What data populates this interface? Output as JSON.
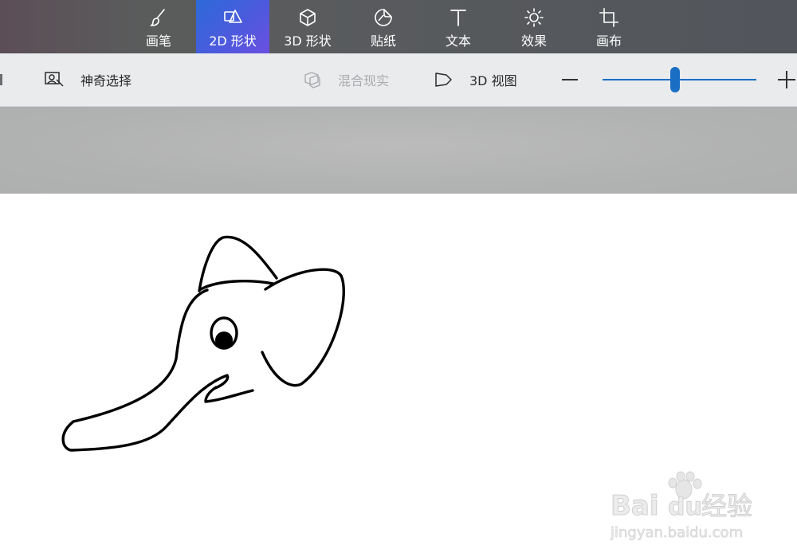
{
  "tabs": [
    {
      "label": "画笔",
      "icon": "brush-icon"
    },
    {
      "label": "2D 形状",
      "icon": "shapes-2d-icon",
      "active": true
    },
    {
      "label": "3D 形状",
      "icon": "cube-icon"
    },
    {
      "label": "贴纸",
      "icon": "sticker-icon"
    },
    {
      "label": "文本",
      "icon": "text-icon"
    },
    {
      "label": "效果",
      "icon": "sun-icon"
    },
    {
      "label": "画布",
      "icon": "canvas-crop-icon"
    }
  ],
  "toolbar": {
    "magic_select": "神奇选择",
    "mixed_reality": "混合现实",
    "view_3d": "3D 视图"
  },
  "zoom": {
    "level_fraction": 0.47
  },
  "colors": {
    "accent": "#1a6fc4",
    "tab_active_start": "#2c6ad8",
    "tab_active_end": "#6b4fe0",
    "toolbar_bg": "#e9ebed",
    "workspace_gray": "#b1b2b2"
  },
  "watermark": {
    "brand_bai": "Bai",
    "brand_du": "du",
    "brand_cn": "经验",
    "url": "jingyan.baidu.com"
  }
}
